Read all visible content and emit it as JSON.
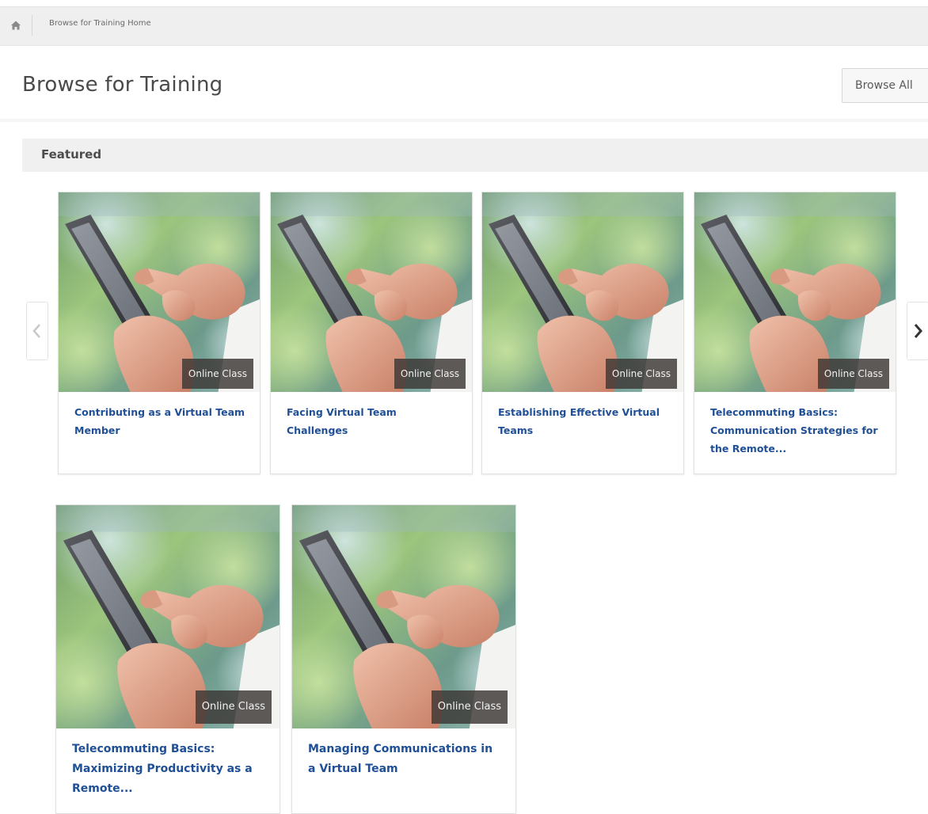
{
  "breadcrumb": {
    "home_icon": "home-icon",
    "current": "Browse for Training Home"
  },
  "header": {
    "title": "Browse for Training",
    "browse_all_label": "Browse All"
  },
  "featured": {
    "heading": "Featured",
    "prev_icon": "chevron-left-icon",
    "next_icon": "chevron-right-icon",
    "cards": [
      {
        "type": "Online Class",
        "title": "Contributing as a Virtual Team Member"
      },
      {
        "type": "Online Class",
        "title": "Facing Virtual Team Challenges"
      },
      {
        "type": "Online Class",
        "title": "Establishing Effective Virtual Teams"
      },
      {
        "type": "Online Class",
        "title": "Telecommuting Basics: Communication Strategies for the Remote..."
      },
      {
        "type": "Online Class",
        "title": "Telecommuting Basics: Maximizing Productivity as a Remote..."
      },
      {
        "type": "Online Class",
        "title": "Managing Communications in a Virtual Team"
      }
    ]
  },
  "colors": {
    "link": "#1f4f96",
    "badge": "#3c3734",
    "section_bg": "#f0f0f0"
  }
}
